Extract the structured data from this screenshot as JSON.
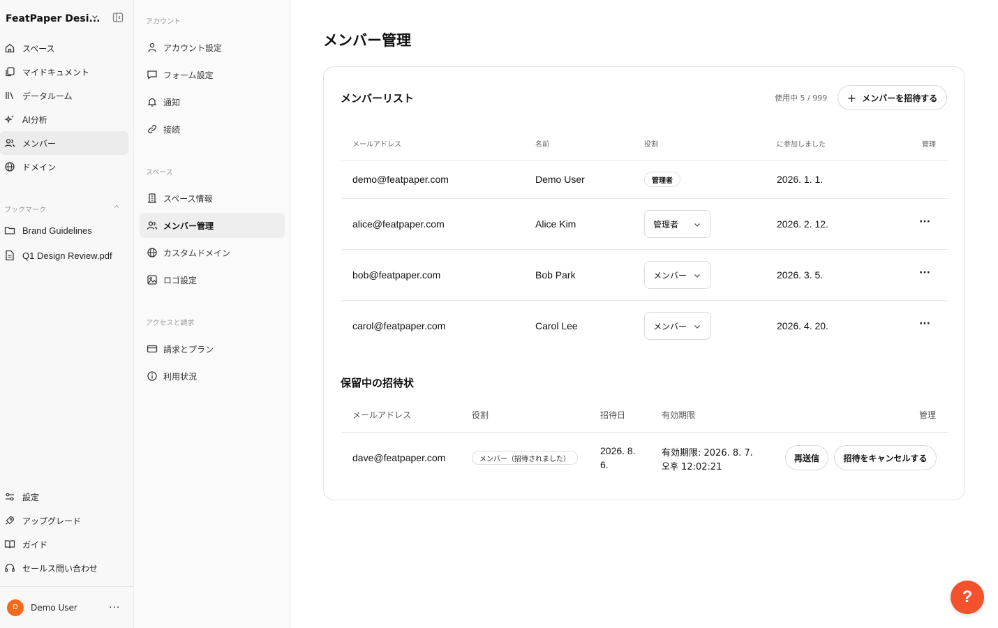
{
  "colors": {
    "accent": "#f4522d",
    "avatar": "#f26b1d",
    "active_bg": "#ececec"
  },
  "sidebar": {
    "workspace_name": "FeatPaper Desi...",
    "nav": [
      {
        "label": "スペース",
        "icon": "home-icon"
      },
      {
        "label": "マイドキュメント",
        "icon": "documents-icon"
      },
      {
        "label": "データルーム",
        "icon": "library-icon"
      },
      {
        "label": "AI分析",
        "icon": "sparkles-icon"
      },
      {
        "label": "メンバー",
        "icon": "users-icon",
        "active": true
      },
      {
        "label": "ドメイン",
        "icon": "globe-icon"
      }
    ],
    "bookmarks_label": "ブックマーク",
    "bookmarks": [
      {
        "label": "Brand Guidelines",
        "icon": "folder-icon"
      },
      {
        "label": "Q1 Design Review.pdf",
        "icon": "file-icon"
      }
    ],
    "bottom": [
      {
        "label": "設定",
        "icon": "sliders-icon"
      },
      {
        "label": "アップグレード",
        "icon": "rocket-icon"
      },
      {
        "label": "ガイド",
        "icon": "book-icon"
      },
      {
        "label": "セールス問い合わせ",
        "icon": "headset-icon"
      }
    ],
    "user": {
      "initial": "D",
      "name": "Demo User",
      "more": "···"
    }
  },
  "settings": {
    "account_label": "アカウント",
    "account_items": [
      {
        "label": "アカウント設定",
        "icon": "user-icon"
      },
      {
        "label": "フォーム設定",
        "icon": "message-square-icon"
      },
      {
        "label": "通知",
        "icon": "bell-icon"
      },
      {
        "label": "接続",
        "icon": "link-icon"
      }
    ],
    "space_label": "スペース",
    "space_items": [
      {
        "label": "スペース情報",
        "icon": "building-icon"
      },
      {
        "label": "メンバー管理",
        "icon": "users-icon",
        "active": true
      },
      {
        "label": "カスタムドメイン",
        "icon": "globe-icon"
      },
      {
        "label": "ロゴ設定",
        "icon": "image-icon"
      }
    ],
    "billing_label": "アクセスと請求",
    "billing_items": [
      {
        "label": "請求とプラン",
        "icon": "credit-card-icon"
      },
      {
        "label": "利用状況",
        "icon": "info-icon"
      }
    ]
  },
  "main": {
    "title": "メンバー管理",
    "members": {
      "title": "メンバーリスト",
      "usage": "使用中 5 / 999",
      "invite_label": "メンバーを招待する",
      "columns": {
        "email": "メールアドレス",
        "name": "名前",
        "role": "役割",
        "joined": "に参加しました",
        "manage": "管理"
      },
      "rows": [
        {
          "email": "demo@featpaper.com",
          "name": "Demo User",
          "role": "管理者",
          "role_editable": false,
          "joined": "2026. 1. 1."
        },
        {
          "email": "alice@featpaper.com",
          "name": "Alice Kim",
          "role": "管理者",
          "role_editable": true,
          "joined": "2026. 2. 12."
        },
        {
          "email": "bob@featpaper.com",
          "name": "Bob Park",
          "role": "メンバー",
          "role_editable": true,
          "joined": "2026. 3. 5."
        },
        {
          "email": "carol@featpaper.com",
          "name": "Carol Lee",
          "role": "メンバー",
          "role_editable": true,
          "joined": "2026. 4. 20."
        }
      ],
      "more_label": "···"
    },
    "pending": {
      "title": "保留中の招待状",
      "columns": {
        "email": "メールアドレス",
        "role": "役割",
        "invited": "招待日",
        "expires": "有効期限",
        "manage": "管理"
      },
      "rows": [
        {
          "email": "dave@featpaper.com",
          "role": "メンバー（招待されました）",
          "invited_line1": "2026. 8.",
          "invited_line2": "6.",
          "expires_line1": "有効期限: 2026. 8. 7.",
          "expires_line2": "오후 12:02:21",
          "resend": "再送信",
          "cancel": "招待をキャンセルする"
        }
      ]
    },
    "help_label": "?"
  }
}
